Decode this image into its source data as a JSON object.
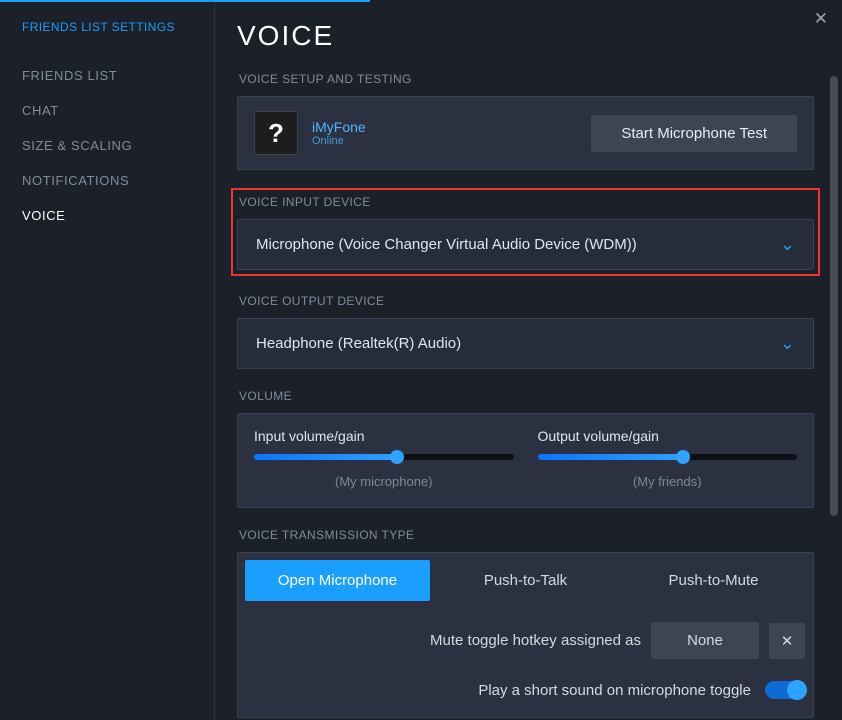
{
  "sidebar": {
    "title": "FRIENDS LIST SETTINGS",
    "items": [
      {
        "label": "FRIENDS LIST",
        "active": false
      },
      {
        "label": "CHAT",
        "active": false
      },
      {
        "label": "SIZE & SCALING",
        "active": false
      },
      {
        "label": "NOTIFICATIONS",
        "active": false
      },
      {
        "label": "VOICE",
        "active": true
      }
    ]
  },
  "page_title": "VOICE",
  "sections": {
    "setup_label": "VOICE SETUP AND TESTING",
    "input_label": "VOICE INPUT DEVICE",
    "output_label": "VOICE OUTPUT DEVICE",
    "volume_label": "VOLUME",
    "transmission_label": "VOICE TRANSMISSION TYPE"
  },
  "user": {
    "name": "iMyFone",
    "status": "Online",
    "avatar_glyph": "?"
  },
  "buttons": {
    "mic_test": "Start Microphone Test"
  },
  "input_device": "Microphone (Voice Changer Virtual Audio Device (WDM))",
  "output_device": "Headphone (Realtek(R) Audio)",
  "volume": {
    "input_label": "Input volume/gain",
    "input_percent": 55,
    "input_sub": "(My microphone)",
    "output_label": "Output volume/gain",
    "output_percent": 56,
    "output_sub": "(My friends)"
  },
  "transmission": {
    "tabs": [
      {
        "label": "Open Microphone",
        "active": true
      },
      {
        "label": "Push-to-Talk",
        "active": false
      },
      {
        "label": "Push-to-Mute",
        "active": false
      }
    ],
    "hotkey_text": "Mute toggle hotkey assigned as",
    "hotkey_value": "None",
    "sound_text": "Play a short sound on microphone toggle",
    "sound_on": true
  }
}
